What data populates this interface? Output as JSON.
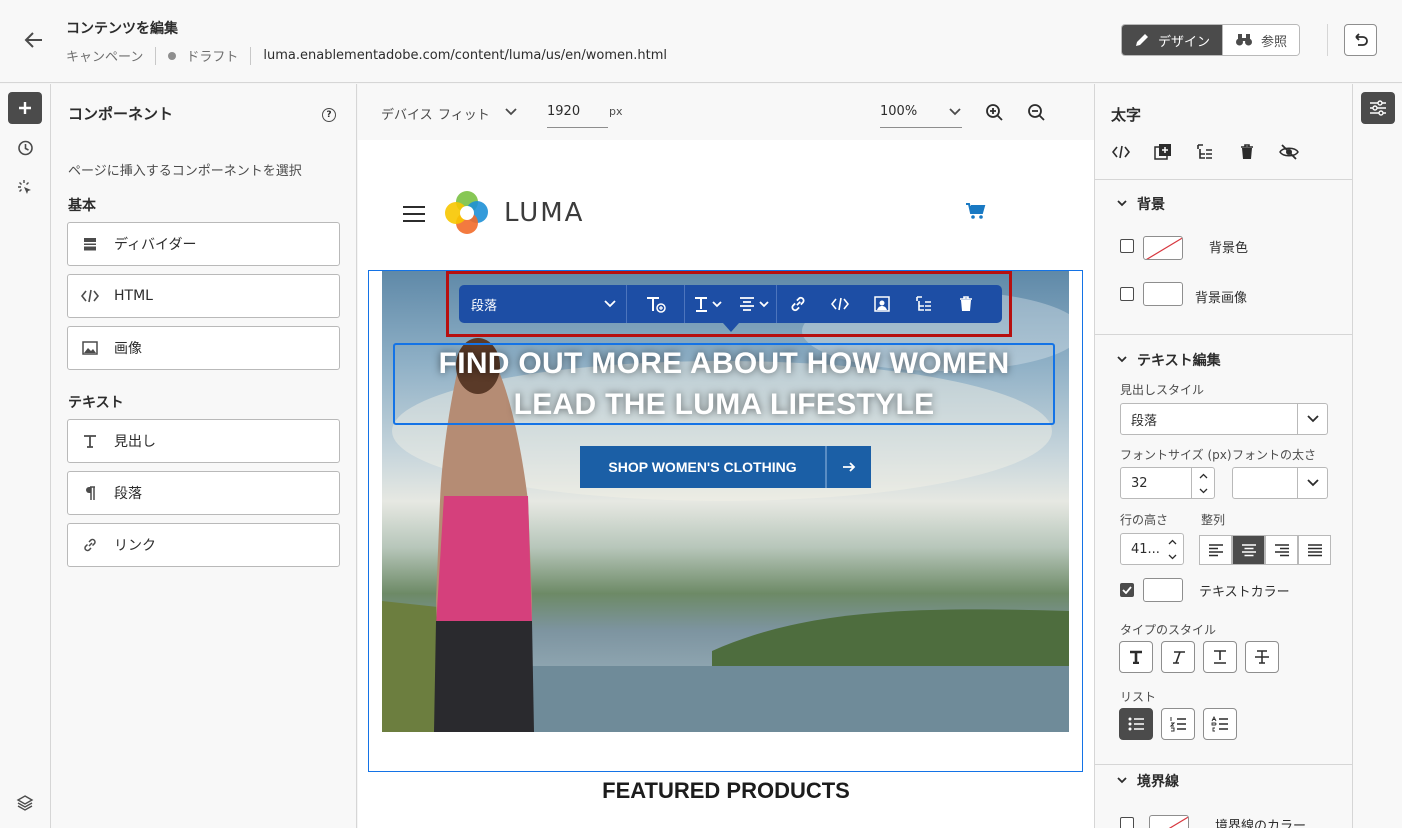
{
  "header": {
    "title": "コンテンツを編集",
    "breadcrumb": {
      "campaign": "キャンペーン",
      "status": "ドラフト",
      "url": "luma.enablementadobe.com/content/luma/us/en/women.html"
    },
    "mode": {
      "design": "デザイン",
      "reference": "参照"
    }
  },
  "components": {
    "title": "コンポーネント",
    "hint": "ページに挿入するコンポーネントを選択",
    "basic_heading": "基本",
    "basic": [
      {
        "label": "ディバイダー"
      },
      {
        "label": "HTML"
      },
      {
        "label": "画像"
      }
    ],
    "text_heading": "テキスト",
    "text": [
      {
        "label": "見出し"
      },
      {
        "label": "段落"
      },
      {
        "label": "リンク"
      }
    ]
  },
  "canvas_bar": {
    "device_label": "デバイス",
    "device_value": "フィット",
    "width_value": "1920",
    "width_unit": "px",
    "zoom": "100%"
  },
  "page": {
    "brand": "LUMA",
    "headline": "FIND OUT MORE ABOUT HOW WOMEN LEAD THE LUMA LIFESTYLE",
    "cta": "SHOP WOMEN'S CLOTHING",
    "featured": "FEATURED PRODUCTS"
  },
  "toolbar": {
    "format": "段落"
  },
  "properties": {
    "title": "太字",
    "background": {
      "heading": "背景",
      "color_label": "背景色",
      "image_label": "背景画像"
    },
    "text_edit": {
      "heading": "テキスト編集",
      "heading_style_label": "見出しスタイル",
      "heading_style_value": "段落",
      "font_size_label": "フォントサイズ (px)",
      "font_size_value": "32",
      "font_weight_label": "フォントの太さ",
      "line_height_label": "行の高さ",
      "line_height_value": "41...",
      "align_label": "整列",
      "text_color_label": "テキストカラー",
      "type_style_label": "タイプのスタイル",
      "list_label": "リスト"
    },
    "border": {
      "heading": "境界線",
      "color_label": "境界線のカラー"
    }
  },
  "colors": {
    "accent": "#1473e6",
    "toolbar": "#1d4ea5",
    "highlight": "#b70f0f",
    "cta": "#1b5fa6"
  }
}
